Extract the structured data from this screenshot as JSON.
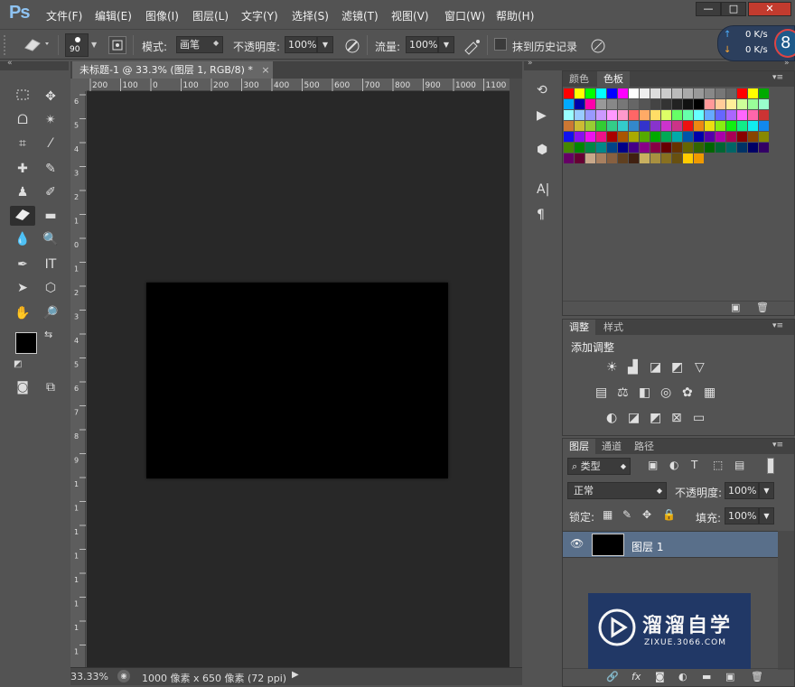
{
  "app": {
    "logo": "Ps"
  },
  "menu": [
    "文件(F)",
    "编辑(E)",
    "图像(I)",
    "图层(L)",
    "文字(Y)",
    "选择(S)",
    "滤镜(T)",
    "视图(V)",
    "窗口(W)",
    "帮助(H)"
  ],
  "window_controls": {
    "minimize": "—",
    "maximize": "□",
    "close": "✕"
  },
  "options": {
    "brush_size": "90",
    "mode_label": "模式:",
    "mode_value": "画笔",
    "opacity_label": "不透明度:",
    "opacity_value": "100%",
    "flow_label": "流量:",
    "flow_value": "100%",
    "erase_history_label": "抹到历史记录"
  },
  "network": {
    "up": "0 K/s",
    "down": "0 K/s",
    "badge": "8"
  },
  "document": {
    "tab_title": "未标题-1 @ 33.3% (图层 1, RGB/8) *",
    "close": "×",
    "ruler_h": [
      "200",
      "100",
      "0",
      "100",
      "200",
      "300",
      "400",
      "500",
      "600",
      "700",
      "800",
      "900",
      "1000",
      "1100"
    ],
    "ruler_v": [
      "6",
      "5",
      "4",
      "3",
      "2",
      "1",
      "0",
      "1",
      "2",
      "3",
      "4",
      "5",
      "6",
      "7",
      "8",
      "9",
      "1",
      "1",
      "1",
      "1",
      "1",
      "1",
      "1",
      "1"
    ],
    "zoom": "33.33%",
    "info": "1000 像素 x 650 像素 (72 ppi)"
  },
  "swatches_panel": {
    "tabs": [
      "颜色",
      "色板"
    ]
  },
  "adjustments_panel": {
    "tabs": [
      "调整",
      "样式"
    ],
    "title": "添加调整"
  },
  "layers_panel": {
    "tabs": [
      "图层",
      "通道",
      "路径"
    ],
    "filter_label": "类型",
    "blend_mode": "正常",
    "opacity_label": "不透明度:",
    "opacity_value": "100%",
    "lock_label": "锁定:",
    "fill_label": "填充:",
    "fill_value": "100%",
    "layers": [
      {
        "name": "图层 1"
      }
    ],
    "footer_fx": "fx"
  },
  "watermark": {
    "title": "溜溜自学",
    "url": "ZIXUE.3066.COM"
  },
  "colors": {
    "ui_bg": "#535353",
    "canvas_bg": "#282828",
    "canvas": "#000000",
    "accent": "#8ec3f2"
  },
  "swatch_colors": [
    [
      "#ff0000",
      "#ffff00",
      "#00ff00",
      "#00ffff",
      "#0000ff",
      "#ff00ff",
      "#ffffff",
      "#eeeeee",
      "#dddddd",
      "#cccccc",
      "#bbbbbb",
      "#aaaaaa",
      "#999999",
      "#888888",
      "#777777",
      "#666666",
      "#ff0000",
      "#ffff00",
      "#00aa00"
    ],
    [
      "#00aaff",
      "#0000aa",
      "#ff00aa",
      "#999999",
      "#888888",
      "#777777",
      "#666666",
      "#555555",
      "#444444",
      "#333333",
      "#222222",
      "#111111",
      "#000000",
      "#ff9999",
      "#ffcc99",
      "#ffee99",
      "#ccff99",
      "#99ff99",
      "#99ffcc"
    ],
    [
      "#99ffff",
      "#99ccff",
      "#9999ff",
      "#cc99ff",
      "#ff99ff",
      "#ff99cc",
      "#ff6666",
      "#ffaa66",
      "#ffdd66",
      "#ddff66",
      "#66ff66",
      "#66ffaa",
      "#66ffff",
      "#66aaff",
      "#6666ff",
      "#aa66ff",
      "#ff66ff",
      "#ff66aa",
      "#cc3333"
    ],
    [
      "#cc7733",
      "#ccbb33",
      "#99cc33",
      "#33cc33",
      "#33cc88",
      "#33cccc",
      "#3388cc",
      "#3333cc",
      "#8833cc",
      "#cc33cc",
      "#cc3388",
      "#ee1111",
      "#ee8811",
      "#eedd11",
      "#88ee11",
      "#11ee11",
      "#11ee88",
      "#11eeee",
      "#1188ee"
    ],
    [
      "#1111ee",
      "#8811ee",
      "#ee11ee",
      "#ee1188",
      "#aa0000",
      "#aa5500",
      "#aaaa00",
      "#55aa00",
      "#00aa00",
      "#00aa55",
      "#00aaaa",
      "#0055aa",
      "#0000aa",
      "#5500aa",
      "#aa00aa",
      "#aa0055",
      "#880000",
      "#884400",
      "#888800"
    ],
    [
      "#448800",
      "#008800",
      "#008844",
      "#008888",
      "#004488",
      "#000088",
      "#440088",
      "#880088",
      "#880044",
      "#660000",
      "#663300",
      "#666600",
      "#336600",
      "#006600",
      "#006633",
      "#006666",
      "#003366",
      "#000066",
      "#330066"
    ],
    [
      "#660066",
      "#660033",
      "#c8a88a",
      "#a88060",
      "#886040",
      "#604020",
      "#402010",
      "#c8b060",
      "#a89040",
      "#887020",
      "#685010",
      "#ffcc00",
      "#ee9900"
    ]
  ]
}
